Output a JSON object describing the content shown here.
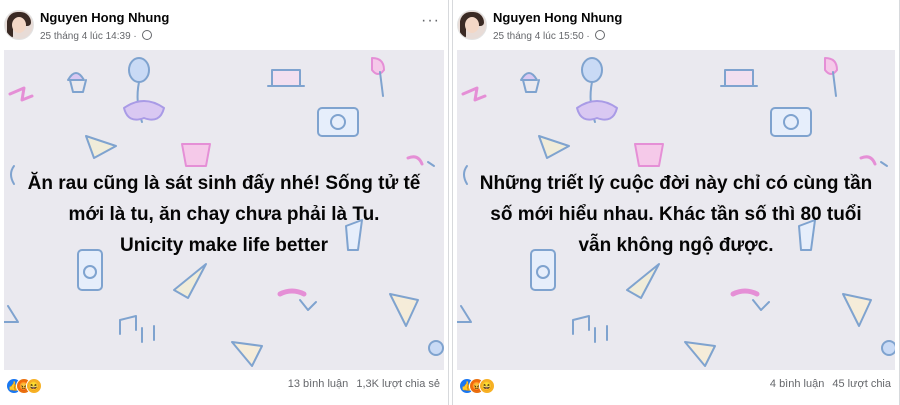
{
  "posts": [
    {
      "author": "Nguyen Hong Nhung",
      "timestamp": "25 tháng 4 lúc 14:39",
      "message_lines": [
        "Ăn rau cũng là sát sinh đấy nhé! Sống tử tế",
        "mới là tu, ăn chay chưa phải là Tu.",
        "Unicity make life better"
      ],
      "comments": "13 bình luận",
      "shares": "1,3K lượt chia sẻ",
      "reactions": [
        "like-icon",
        "angry-icon",
        "haha-icon"
      ]
    },
    {
      "author": "Nguyen Hong Nhung",
      "timestamp": "25 tháng 4 lúc 15:50",
      "message_lines": [
        "Những triết lý cuộc đời này chỉ có cùng tần",
        "số mới hiểu nhau. Khác tần số thì 80 tuổi",
        "vẫn không ngộ được."
      ],
      "comments": "4 bình luận",
      "shares": "45 lượt chia",
      "reactions": [
        "like-icon",
        "angry-icon",
        "haha-icon"
      ]
    }
  ],
  "colors": {
    "background_pattern": "#eae9ef",
    "doodle_blue": "#7fa3cf",
    "doodle_pink": "#e58fd6",
    "doodle_purple": "#a99be6"
  }
}
